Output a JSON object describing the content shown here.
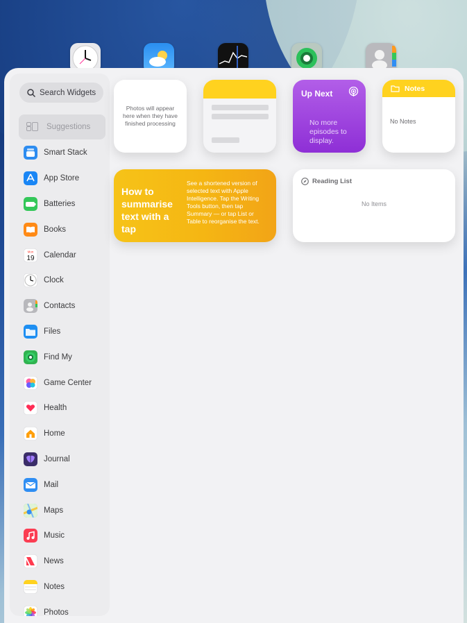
{
  "home_icons": [
    "clock-app-icon",
    "weather-app-icon",
    "stocks-app-icon",
    "find-my-app-icon",
    "contacts-app-icon"
  ],
  "search": {
    "placeholder": "Search Widgets"
  },
  "sidebar": {
    "suggestions_label": "Suggestions",
    "apps": [
      {
        "label": "Smart Stack",
        "icon": "smart-stack-icon",
        "color": "#2d8cf0"
      },
      {
        "label": "App Store",
        "icon": "app-store-icon",
        "color": "#1a86f5"
      },
      {
        "label": "Batteries",
        "icon": "battery-icon",
        "color": "#34c759"
      },
      {
        "label": "Books",
        "icon": "books-icon",
        "color": "#ff8a16"
      },
      {
        "label": "Calendar",
        "icon": "calendar-icon",
        "color": "#ffffff",
        "glyph_top": "Mon",
        "glyph": "19"
      },
      {
        "label": "Clock",
        "icon": "clock-icon",
        "color": "#ffffff"
      },
      {
        "label": "Contacts",
        "icon": "contacts-icon",
        "color": "#b8b8bc"
      },
      {
        "label": "Files",
        "icon": "files-icon",
        "color": "#1e8ff2"
      },
      {
        "label": "Find My",
        "icon": "find-my-icon",
        "color": "#30b350"
      },
      {
        "label": "Game Center",
        "icon": "game-center-icon",
        "color": "#ffffff"
      },
      {
        "label": "Health",
        "icon": "health-icon",
        "color": "#ffffff"
      },
      {
        "label": "Home",
        "icon": "home-icon",
        "color": "#ffffff"
      },
      {
        "label": "Journal",
        "icon": "journal-icon",
        "color": "#3a2d68"
      },
      {
        "label": "Mail",
        "icon": "mail-icon",
        "color": "#2f8ef3"
      },
      {
        "label": "Maps",
        "icon": "maps-icon",
        "color": "#6cc36b"
      },
      {
        "label": "Music",
        "icon": "music-icon",
        "color": "#fb3d52"
      },
      {
        "label": "News",
        "icon": "news-icon",
        "color": "#ffffff"
      },
      {
        "label": "Notes",
        "icon": "notes-icon",
        "color": "#ffffff"
      },
      {
        "label": "Photos",
        "icon": "photos-icon",
        "color": "#ffffff"
      }
    ]
  },
  "widgets": {
    "photos": {
      "text": "Photos will appear here when they have finished processing"
    },
    "up_next": {
      "title": "Up Next",
      "text": "No more episodes to display."
    },
    "notes": {
      "title": "Notes",
      "empty": "No Notes"
    },
    "tips": {
      "heading": "How to summarise text with a tap",
      "body": "See a shortened version of selected text with Apple Intelligence. Tap the Writing Tools button, then tap Summary — or tap List or Table to reorganise the text."
    },
    "reading_list": {
      "title": "Reading List",
      "empty": "No Items"
    }
  },
  "colors": {
    "notes_yellow": "#ffd21f",
    "podcasts_purple": "#9b3fe0",
    "tips_orange": "#f5b613"
  }
}
